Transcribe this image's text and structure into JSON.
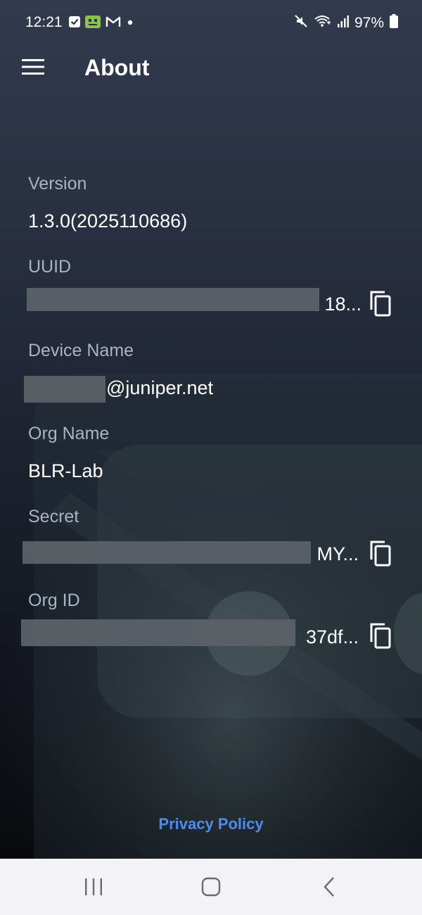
{
  "status_bar": {
    "time": "12:21",
    "battery": "97%",
    "notification_icons": [
      "check-task-icon",
      "chat-bot-icon",
      "gmail-icon",
      "dot-icon"
    ],
    "system_icons": [
      "mute-icon",
      "wifi-calling-icon",
      "signal-icon",
      "battery-icon"
    ]
  },
  "app_bar": {
    "title": "About",
    "menu_icon": "hamburger-menu-icon"
  },
  "fields": {
    "version": {
      "label": "Version",
      "value": "1.3.0(2025110686)"
    },
    "uuid": {
      "label": "UUID",
      "value": "18..."
    },
    "device_name": {
      "label": "Device Name",
      "value": "@juniper.net"
    },
    "org_name": {
      "label": "Org Name",
      "value": "BLR-Lab"
    },
    "secret": {
      "label": "Secret",
      "value": "MY..."
    },
    "org_id": {
      "label": "Org ID",
      "value": "37df..."
    }
  },
  "footer": {
    "privacy_policy": "Privacy Policy"
  },
  "colors": {
    "accent_link": "#4a8df0",
    "label": "#aab3c4",
    "value": "#ffffff",
    "nav_bar_bg": "#f3f3f5"
  },
  "nav_bar": {
    "buttons": [
      "recent-apps-icon",
      "home-icon",
      "back-icon"
    ]
  }
}
